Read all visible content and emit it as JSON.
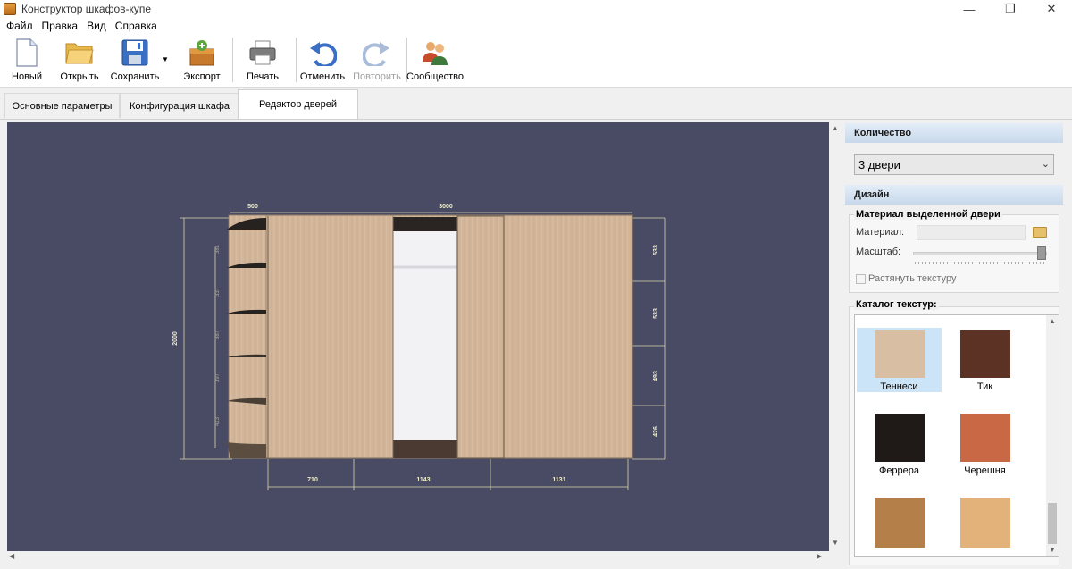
{
  "window": {
    "title": "Конструктор шкафов-купе",
    "minimize": "—",
    "maximize": "❐",
    "close": "✕"
  },
  "menu": [
    "Файл",
    "Правка",
    "Вид",
    "Справка"
  ],
  "toolbar": {
    "new": "Новый",
    "open": "Открыть",
    "save": "Сохранить",
    "export": "Экспорт",
    "print": "Печать",
    "undo": "Отменить",
    "redo": "Повторить",
    "community": "Сообщество"
  },
  "tabs": [
    "Основные параметры",
    "Конфигурация шкафа",
    "Редактор дверей"
  ],
  "active_tab": "Редактор дверей",
  "drawing": {
    "width_label": "3000",
    "left_section_label": "500",
    "height_label": "2000",
    "shelf_heights": [
      "381",
      "337",
      "387",
      "397",
      "413"
    ],
    "right_heights": [
      "533",
      "533",
      "493",
      "426"
    ],
    "door_widths": [
      "710",
      "1143",
      "1131"
    ]
  },
  "panel": {
    "quantity_header": "Количество",
    "quantity_value": "3 двери",
    "design_header": "Дизайн",
    "selected_material_title": "Материал выделенной двери",
    "material_label": "Материал:",
    "scale_label": "Масштаб:",
    "stretch_label": "Растянуть текстуру",
    "catalog_title": "Каталог текстур:",
    "textures": [
      {
        "name": "Теннеси",
        "color": "#d8bea3"
      },
      {
        "name": "Тик",
        "color": "#5b3224"
      },
      {
        "name": "Феррера",
        "color": "#1f1a17"
      },
      {
        "name": "Черешня",
        "color": "#c86844"
      },
      {
        "name": "",
        "color": "#b47f49"
      },
      {
        "name": "",
        "color": "#e2b27a"
      }
    ]
  },
  "colors": {
    "canvas_bg": "#494a64",
    "wood": "#d2b69b",
    "dim_line": "#d8d8a8"
  }
}
